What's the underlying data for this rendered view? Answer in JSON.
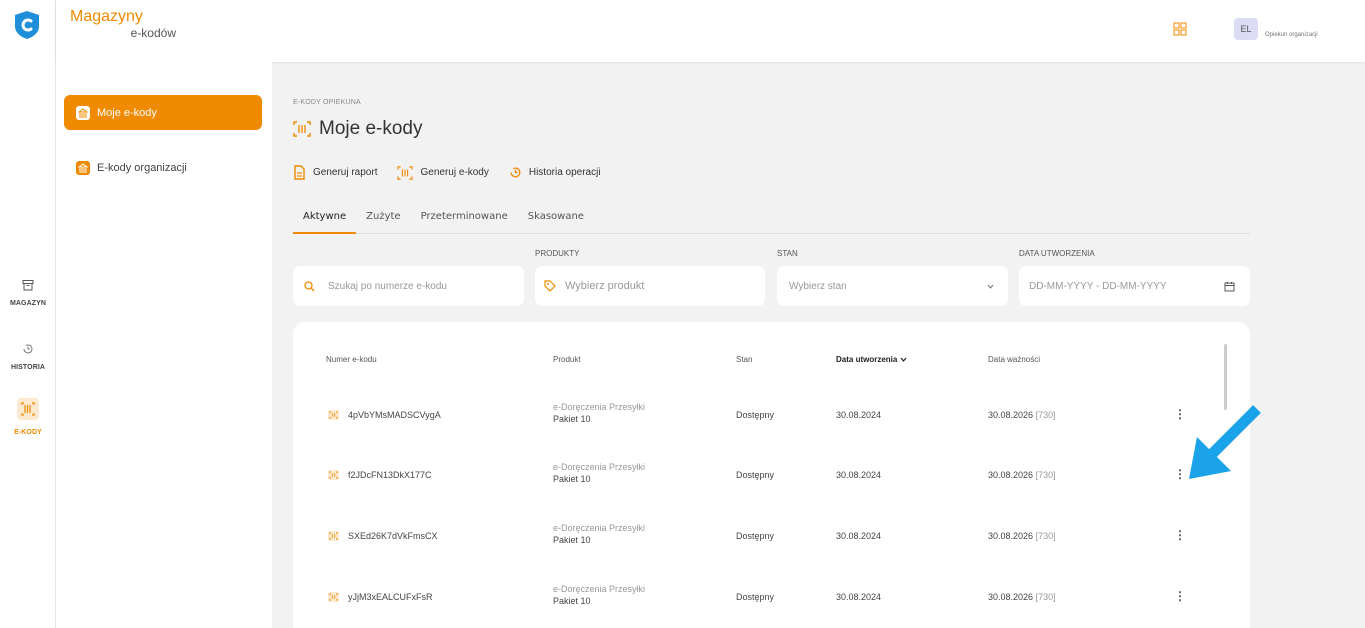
{
  "rail": {
    "items": [
      {
        "label": "MAGAZYN",
        "icon": "archive-icon"
      },
      {
        "label": "HISTORIA",
        "icon": "history-icon"
      },
      {
        "label": "E-KODY",
        "icon": "barcode-icon"
      }
    ]
  },
  "header": {
    "title_line1": "Magazyny",
    "title_line2": "e-kodów",
    "avatar_initials": "EL",
    "role": "Opiekun organizacji"
  },
  "sidebar": {
    "items": [
      {
        "label": "Moje e-kody",
        "active": true
      },
      {
        "label": "E-kody organizacji",
        "active": false
      }
    ]
  },
  "main": {
    "breadcrumb": "E-KODY OPIEKUNA",
    "title": "Moje e-kody",
    "actions": [
      {
        "label": "Generuj raport",
        "icon": "report-icon"
      },
      {
        "label": "Generuj e-kody",
        "icon": "barcode-icon"
      },
      {
        "label": "Historia operacji",
        "icon": "history-icon"
      }
    ],
    "tabs": [
      {
        "label": "Aktywne",
        "active": true
      },
      {
        "label": "Zużyte",
        "active": false
      },
      {
        "label": "Przeterminowane",
        "active": false
      },
      {
        "label": "Skasowane",
        "active": false
      }
    ],
    "filters": {
      "search_placeholder": "Szukaj po numerze e-kodu",
      "product_label": "PRODUKTY",
      "product_placeholder": "Wybierz produkt",
      "state_label": "STAN",
      "state_placeholder": "Wybierz stan",
      "date_label": "DATA UTWORZENIA",
      "date_placeholder": "DD-MM-YYYY - DD-MM-YYYY"
    },
    "table": {
      "columns": [
        "Numer e-kodu",
        "Produkt",
        "Stan",
        "Data utworzenia",
        "Data ważności"
      ],
      "rows": [
        {
          "code": "4pVbYMsMADSCVygA",
          "product_line1": "e-Doręczenia Przesyłki",
          "product_line2": "Pakiet 10",
          "state": "Dostępny",
          "created": "30.08.2024",
          "expires": "30.08.2026",
          "days": "[730]"
        },
        {
          "code": "f2JDcFN13DkX177C",
          "product_line1": "e-Doręczenia Przesyłki",
          "product_line2": "Pakiet 10",
          "state": "Dostępny",
          "created": "30.08.2024",
          "expires": "30.08.2026",
          "days": "[730]"
        },
        {
          "code": "SXEd26K7dVkFmsCX",
          "product_line1": "e-Doręczenia Przesyłki",
          "product_line2": "Pakiet 10",
          "state": "Dostępny",
          "created": "30.08.2024",
          "expires": "30.08.2026",
          "days": "[730]"
        },
        {
          "code": "yJjM3xEALCUFxFsR",
          "product_line1": "e-Doręczenia Przesyłki",
          "product_line2": "Pakiet 10",
          "state": "Dostępny",
          "created": "30.08.2024",
          "expires": "30.08.2026",
          "days": "[730]"
        }
      ]
    }
  },
  "colors": {
    "accent": "#f08a00",
    "logo_blue": "#1e8fd8",
    "arrow_blue": "#1aa3e8"
  }
}
